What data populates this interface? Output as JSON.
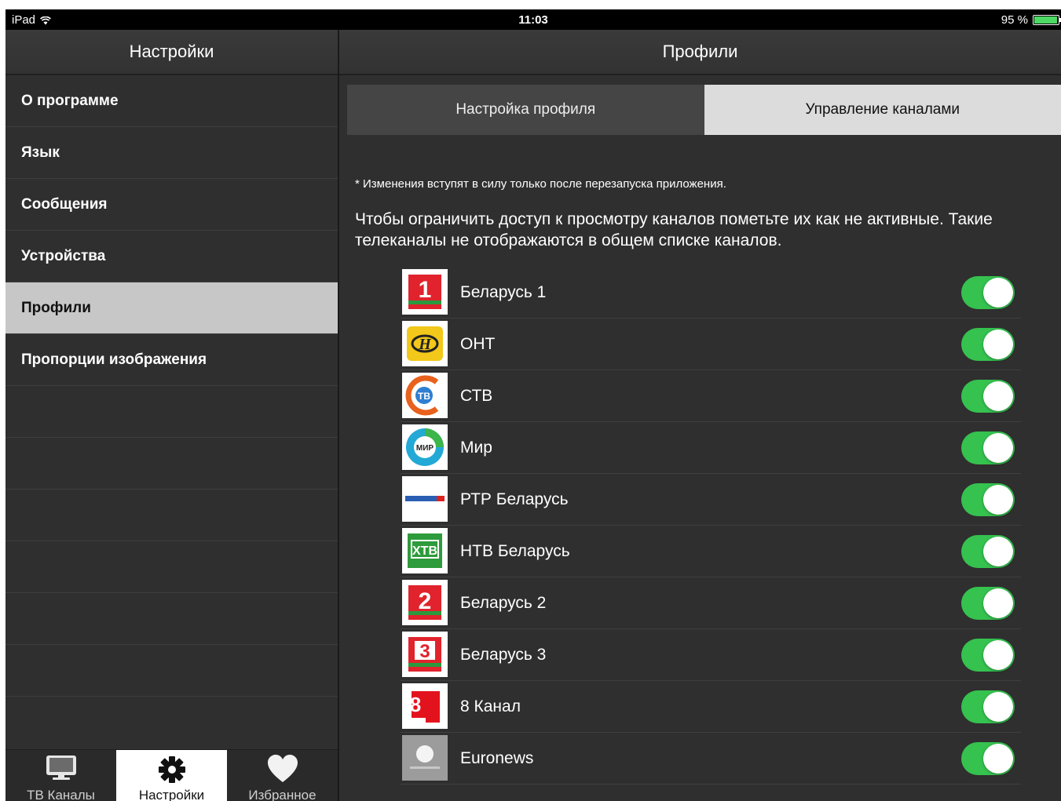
{
  "status_bar": {
    "device": "iPad",
    "time": "11:03",
    "battery": "95 %",
    "battery_level": 0.95
  },
  "sidebar": {
    "title": "Настройки",
    "items": [
      {
        "label": "О программе"
      },
      {
        "label": "Язык"
      },
      {
        "label": "Сообщения"
      },
      {
        "label": "Устройства"
      },
      {
        "label": "Профили",
        "active": true
      },
      {
        "label": "Пропорции изображения"
      }
    ]
  },
  "tabbar": {
    "tabs": [
      {
        "label": "ТВ Каналы",
        "icon": "monitor-icon"
      },
      {
        "label": "Настройки",
        "icon": "gear-icon",
        "active": true
      },
      {
        "label": "Избранное",
        "icon": "heart-icon"
      }
    ]
  },
  "main": {
    "title": "Профили",
    "segments": [
      {
        "label": "Настройка профиля"
      },
      {
        "label": "Управление каналами",
        "active": true
      }
    ],
    "note": "* Изменения вступят в силу только после перезапуска приложения.",
    "description_line1": "Чтобы ограничить доступ к просмотру каналов пометьте их как не активные. Такие",
    "description_line2": "телеканалы не отображаются в общем списке каналов.",
    "channels": [
      {
        "name": "Беларусь 1",
        "enabled": true,
        "logo": "belarus1-logo"
      },
      {
        "name": "ОНТ",
        "enabled": true,
        "logo": "ont-logo"
      },
      {
        "name": "СТВ",
        "enabled": true,
        "logo": "ctv-logo"
      },
      {
        "name": "Мир",
        "enabled": true,
        "logo": "mir-logo"
      },
      {
        "name": "РТР Беларусь",
        "enabled": true,
        "logo": "rtr-logo"
      },
      {
        "name": "НТВ Беларусь",
        "enabled": true,
        "logo": "ntv-logo"
      },
      {
        "name": "Беларусь 2",
        "enabled": true,
        "logo": "belarus2-logo"
      },
      {
        "name": "Беларусь 3",
        "enabled": true,
        "logo": "belarus3-logo"
      },
      {
        "name": "8 Канал",
        "enabled": true,
        "logo": "8kanal-logo"
      },
      {
        "name": "Euronews",
        "enabled": true,
        "logo": "euronews-logo"
      }
    ]
  },
  "colors": {
    "toggle_on": "#35c24f",
    "active_row": "#c7c7c7",
    "background": "#2f2f2f"
  }
}
